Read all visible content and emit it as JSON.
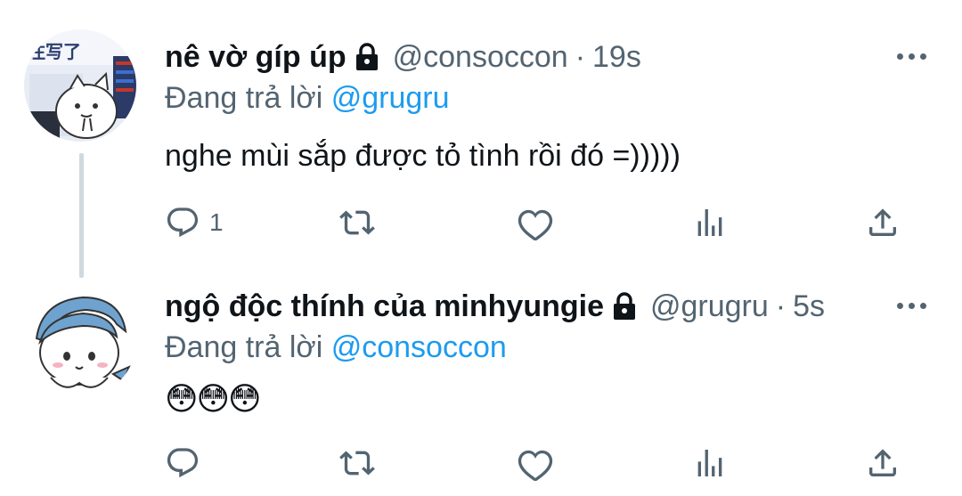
{
  "tweets": [
    {
      "display_name": "nê vờ gíp úp",
      "handle": "@consoccon",
      "separator": "·",
      "time": "19s",
      "reply_prefix": "Đang trả lời",
      "reply_to": "@grugru",
      "text": "nghe mùi sắp được tỏ tình rồi đó =)))))",
      "reply_count": "1",
      "avatar_text": "注写了"
    },
    {
      "display_name": "ngộ độc thính của minhyungie",
      "handle": "@grugru",
      "separator": "·",
      "time": "5s",
      "reply_prefix": "Đang trả lời",
      "reply_to": "@consoccon",
      "text": "😳😳😳",
      "reply_count": ""
    }
  ],
  "colors": {
    "text": "#0f1419",
    "secondary": "#536471",
    "mention": "#1d9bf0",
    "thread_line": "#cfd9de"
  },
  "icons": [
    "lock-icon",
    "more-icon",
    "reply-icon",
    "retweet-icon",
    "like-icon",
    "stats-icon",
    "share-icon"
  ]
}
